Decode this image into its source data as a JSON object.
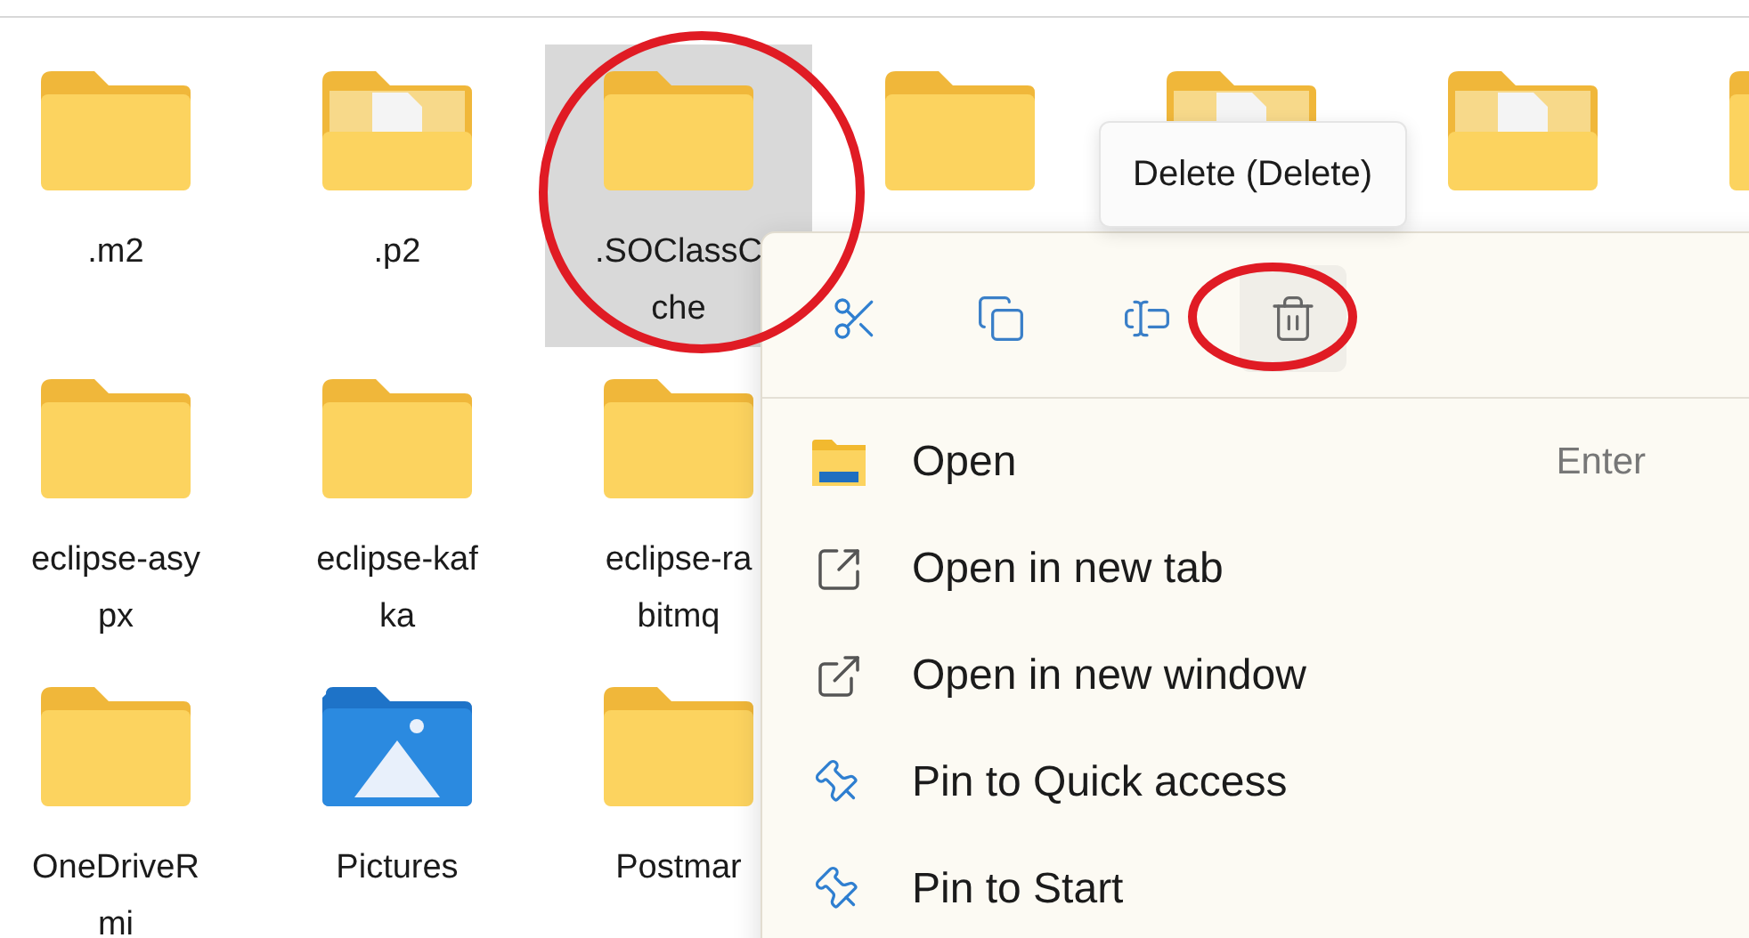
{
  "file_rows": [
    [
      {
        "kind": "folder",
        "label_lines": [
          ".m2"
        ],
        "selected": false
      },
      {
        "kind": "folder-docs",
        "label_lines": [
          ".p2"
        ],
        "selected": false
      },
      {
        "kind": "folder",
        "label_lines": [
          ".SOClassC",
          "che"
        ],
        "selected": true
      },
      {
        "kind": "folder",
        "selected": false
      },
      {
        "kind": "folder-docs",
        "selected": false
      },
      {
        "kind": "folder-docs",
        "selected": false
      },
      {
        "kind": "folder",
        "selected": false
      }
    ],
    [
      {
        "kind": "folder",
        "label_lines": [
          "eclipse-asy",
          "px"
        ],
        "selected": false
      },
      {
        "kind": "folder",
        "label_lines": [
          "eclipse-kaf",
          "ka"
        ],
        "selected": false
      },
      {
        "kind": "folder",
        "label_lines": [
          "eclipse-ra",
          "bitmq"
        ],
        "selected": false
      }
    ],
    [
      {
        "kind": "folder",
        "label_lines": [
          "OneDriveR",
          "mi"
        ],
        "selected": false
      },
      {
        "kind": "pictures",
        "label_lines": [
          "Pictures"
        ],
        "selected": false
      },
      {
        "kind": "folder",
        "label_lines": [
          "Postmar"
        ],
        "selected": false
      }
    ]
  ],
  "context_menu": {
    "toolbar": [
      {
        "kind": "cut",
        "hovered": false
      },
      {
        "kind": "copy",
        "hovered": false
      },
      {
        "kind": "rename",
        "hovered": false
      },
      {
        "kind": "delete",
        "hovered": true
      }
    ],
    "tooltip": "Delete (Delete)",
    "items": [
      {
        "kind": "open",
        "label": "Open",
        "shortcut": "Enter"
      },
      {
        "kind": "new-tab",
        "label": "Open in new tab"
      },
      {
        "kind": "new-window",
        "label": "Open in new window"
      },
      {
        "kind": "pin",
        "label": "Pin to Quick access"
      },
      {
        "kind": "pin",
        "label": "Pin to Start"
      }
    ]
  }
}
